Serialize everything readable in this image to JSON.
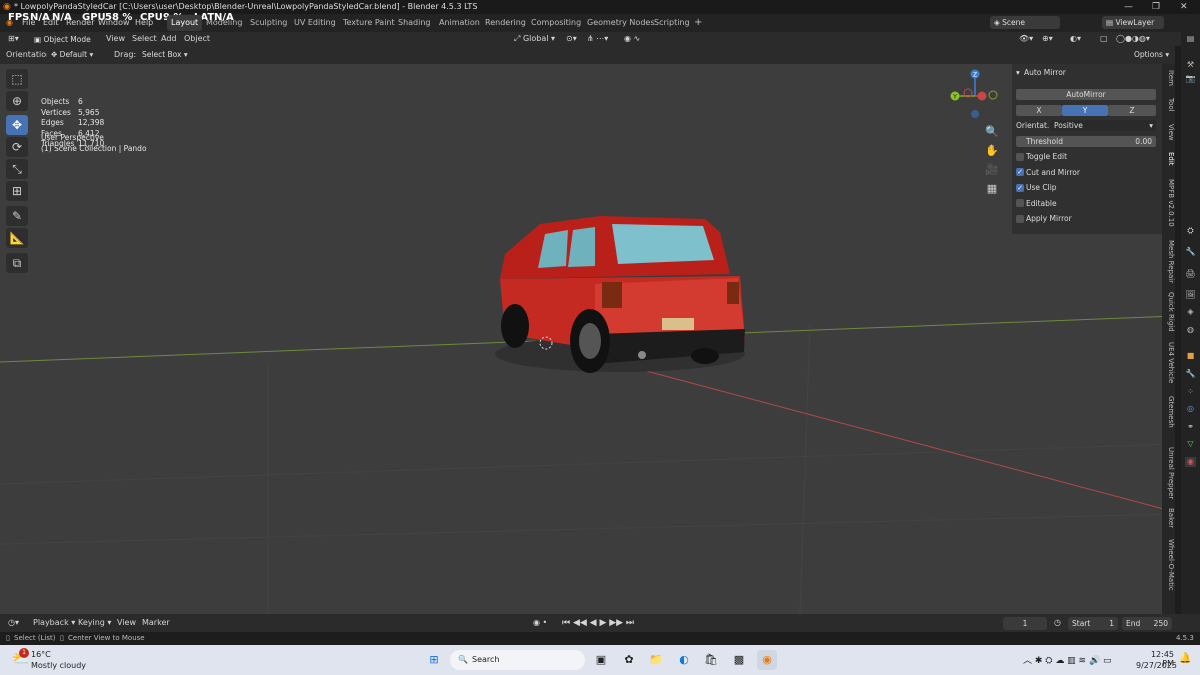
{
  "window": {
    "title": "* LowpolyPandaStyledCar [C:\\Users\\user\\Desktop\\Blender-Unreal\\LowpolyPandaStyledCar.blend] - Blender 4.5.3 LTS"
  },
  "menu": [
    "File",
    "Edit",
    "Render",
    "Window",
    "Help"
  ],
  "hud": {
    "fps_label": "FPS",
    "fps": "N/A",
    "fps2": "N/A",
    "gpu_label": "GPU",
    "gpu": "58 %",
    "cpu_label": "CPU",
    "cpu": "9 %",
    "lat_label": "LAT",
    "lat": "N/A"
  },
  "workspaces": [
    "Layout",
    "Modeling",
    "Sculpting",
    "UV Editing",
    "Texture Paint",
    "Shading",
    "Animation",
    "Rendering",
    "Compositing",
    "Geometry Nodes",
    "Scripting"
  ],
  "scene": {
    "scene_label": "Scene",
    "viewlayer_label": "ViewLayer"
  },
  "toolheader": {
    "orientation_label": "Orientation:",
    "orientation_value": "Default",
    "drag_label": "Drag:",
    "drag_value": "Select Box",
    "options": "Options"
  },
  "header": {
    "mode": "Object Mode",
    "view": "View",
    "select": "Select",
    "add": "Add",
    "object": "Object",
    "transform": "Global"
  },
  "viewport": {
    "perspective": "User Perspective",
    "collection": "(1) Scene Collection | Pando",
    "stats": [
      {
        "label": "Objects",
        "value": "6"
      },
      {
        "label": "Vertices",
        "value": "5,965"
      },
      {
        "label": "Edges",
        "value": "12,398"
      },
      {
        "label": "Faces",
        "value": "6,412"
      },
      {
        "label": "Triangles",
        "value": "11,710"
      }
    ]
  },
  "gizmo": {
    "z": "Z",
    "y": "Y",
    "x": "X"
  },
  "npanel": {
    "title": "Auto Mirror",
    "automirror_btn": "AutoMirror",
    "axes": [
      "X",
      "Y",
      "Z"
    ],
    "orientation_label": "Orientat...",
    "orientation_value": "Positive",
    "threshold_label": "Threshold",
    "threshold_value": "0.00",
    "options": [
      {
        "label": "Toggle Edit",
        "checked": false
      },
      {
        "label": "Cut and Mirror",
        "checked": true
      },
      {
        "label": "Use Clip",
        "checked": true
      },
      {
        "label": "Editable",
        "checked": false
      },
      {
        "label": "Apply Mirror",
        "checked": false
      }
    ]
  },
  "sidetabs": [
    "Item",
    "Tool",
    "View",
    "Edit",
    "MPFB v2.0.10",
    "Mesh Repair",
    "Quick Rigid",
    "UE4 Vehicle",
    "Gtemesh",
    "Unreal Prepper",
    "Baker",
    "Wheel-O-Matic"
  ],
  "timeline": {
    "playback": "Playback",
    "keying": "Keying",
    "view": "View",
    "marker": "Marker",
    "frame": "1",
    "start_label": "Start",
    "start": "1",
    "end_label": "End",
    "end": "250"
  },
  "statusbar": {
    "select": "Select (List)",
    "center": "Center View to Mouse",
    "version": "4.5.3"
  },
  "taskbar": {
    "temp": "16°C",
    "weather": "Mostly cloudy",
    "search": "Search",
    "time": "12:45 PM",
    "date": "9/27/2025",
    "badge": "1"
  }
}
